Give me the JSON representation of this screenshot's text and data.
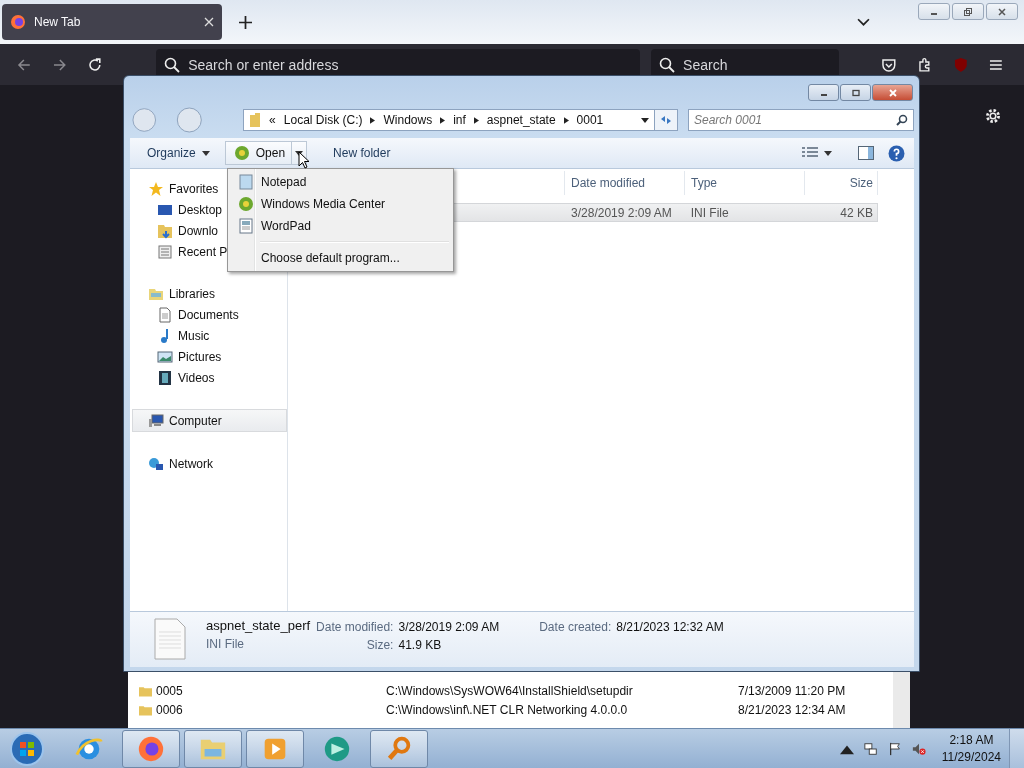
{
  "browser": {
    "tabs": [
      {
        "title": "New Tab",
        "selected": true
      }
    ],
    "address_placeholder": "Search or enter address",
    "search_placeholder": "Search"
  },
  "dialog": {
    "crumb_overflow": "«",
    "crumbs": [
      "Local Disk (C:)",
      "Windows",
      "inf",
      "aspnet_state",
      "0001"
    ],
    "search_placeholder": "Search 0001",
    "toolbar": {
      "organize": "Organize",
      "open": "Open",
      "new_folder": "New folder"
    },
    "menu": [
      {
        "label": "Notepad",
        "kind": "notepad"
      },
      {
        "label": "Windows Media Center",
        "kind": "mediacenter"
      },
      {
        "label": "WordPad",
        "kind": "wordpad"
      },
      {
        "label": "Choose default program...",
        "kind": "command"
      }
    ],
    "nav": [
      {
        "label": "Favorites",
        "kind": "star",
        "selected": false,
        "children": [
          {
            "label": "Desktop",
            "kind": "desktop",
            "selected": false
          },
          {
            "label": "Downlo",
            "kind": "downloads",
            "selected": false
          },
          {
            "label": "Recent P",
            "kind": "recent",
            "selected": false
          }
        ]
      },
      {
        "label": "Libraries",
        "kind": "library",
        "selected": false,
        "children": [
          {
            "label": "Documents",
            "kind": "documents",
            "selected": false
          },
          {
            "label": "Music",
            "kind": "music",
            "selected": false
          },
          {
            "label": "Pictures",
            "kind": "pictures",
            "selected": false
          },
          {
            "label": "Videos",
            "kind": "videos",
            "selected": false
          }
        ]
      },
      {
        "label": "Computer",
        "kind": "computer",
        "selected": true
      },
      {
        "label": "Network",
        "kind": "network",
        "selected": false
      }
    ],
    "columns": [
      "Date modified",
      "Type",
      "Size"
    ],
    "rows": [
      {
        "date": "3/28/2019 2:09 AM",
        "type": "INI File",
        "size": "42 KB",
        "selected": true
      }
    ],
    "details": {
      "name": "aspnet_state_perf",
      "type": "INI File",
      "modified_label": "Date modified:",
      "modified": "3/28/2019 2:09 AM",
      "size_label": "Size:",
      "size": "41.9 KB",
      "created_label": "Date created:",
      "created": "8/21/2023 12:32 AM"
    }
  },
  "background_list": [
    {
      "name": "0005",
      "path": "C:\\Windows\\SysWOW64\\InstallShield\\setupdir",
      "date": "7/13/2009 11:20 PM"
    },
    {
      "name": "0006",
      "path": "C:\\Windows\\inf\\.NET CLR Networking 4.0.0.0",
      "date": "8/21/2023 12:34 AM"
    }
  ],
  "taskbar": {
    "apps": [
      {
        "kind": "ie",
        "open": false
      },
      {
        "kind": "firefox",
        "open": true
      },
      {
        "kind": "explorer",
        "open": true
      },
      {
        "kind": "player",
        "open": true
      },
      {
        "kind": "teal",
        "open": false
      },
      {
        "kind": "magnifier",
        "open": true
      }
    ],
    "time": "2:18 AM",
    "date": "11/29/2024"
  }
}
